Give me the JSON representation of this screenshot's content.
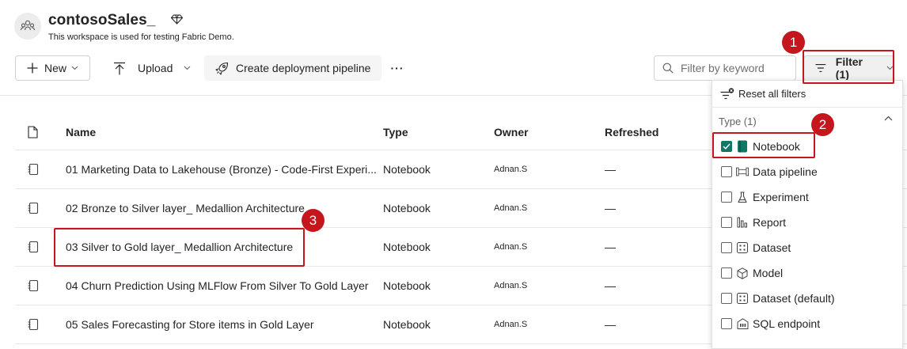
{
  "workspace": {
    "name": "contosoSales_",
    "description": "This workspace is used for testing Fabric Demo."
  },
  "toolbar": {
    "new_label": "New",
    "upload_label": "Upload",
    "pipeline_label": "Create deployment pipeline",
    "more_label": "···",
    "search_placeholder": "Filter by keyword",
    "filter_label": "Filter (1)"
  },
  "table": {
    "headers": {
      "name": "Name",
      "type": "Type",
      "owner": "Owner",
      "refreshed": "Refreshed"
    },
    "rows": [
      {
        "name": "01 Marketing Data to Lakehouse (Bronze) - Code-First Experi...",
        "type": "Notebook",
        "owner": "Adnan.S",
        "refreshed": "—"
      },
      {
        "name": "02 Bronze to Silver layer_ Medallion Architecture",
        "type": "Notebook",
        "owner": "Adnan.S",
        "refreshed": "—"
      },
      {
        "name": "03 Silver to Gold layer_ Medallion Architecture",
        "type": "Notebook",
        "owner": "Adnan.S",
        "refreshed": "—"
      },
      {
        "name": "04 Churn Prediction Using MLFlow From Silver To Gold Layer",
        "type": "Notebook",
        "owner": "Adnan.S",
        "refreshed": "—"
      },
      {
        "name": "05 Sales Forecasting for Store items in Gold Layer",
        "type": "Notebook",
        "owner": "Adnan.S",
        "refreshed": "—"
      }
    ]
  },
  "filter_panel": {
    "reset_label": "Reset all filters",
    "group_label": "Type (1)",
    "items": [
      {
        "label": "Notebook",
        "checked": true,
        "icon": "notebook-icon"
      },
      {
        "label": "Data pipeline",
        "checked": false,
        "icon": "pipeline-icon"
      },
      {
        "label": "Experiment",
        "checked": false,
        "icon": "flask-icon"
      },
      {
        "label": "Report",
        "checked": false,
        "icon": "report-icon"
      },
      {
        "label": "Dataset",
        "checked": false,
        "icon": "dataset-icon"
      },
      {
        "label": "Model",
        "checked": false,
        "icon": "cube-icon"
      },
      {
        "label": "Dataset (default)",
        "checked": false,
        "icon": "dataset-icon"
      },
      {
        "label": "SQL endpoint",
        "checked": false,
        "icon": "sql-endpoint-icon"
      }
    ]
  },
  "callouts": [
    "1",
    "2",
    "3"
  ],
  "colors": {
    "accent": "#117865",
    "callout_red": "#c4161c"
  }
}
